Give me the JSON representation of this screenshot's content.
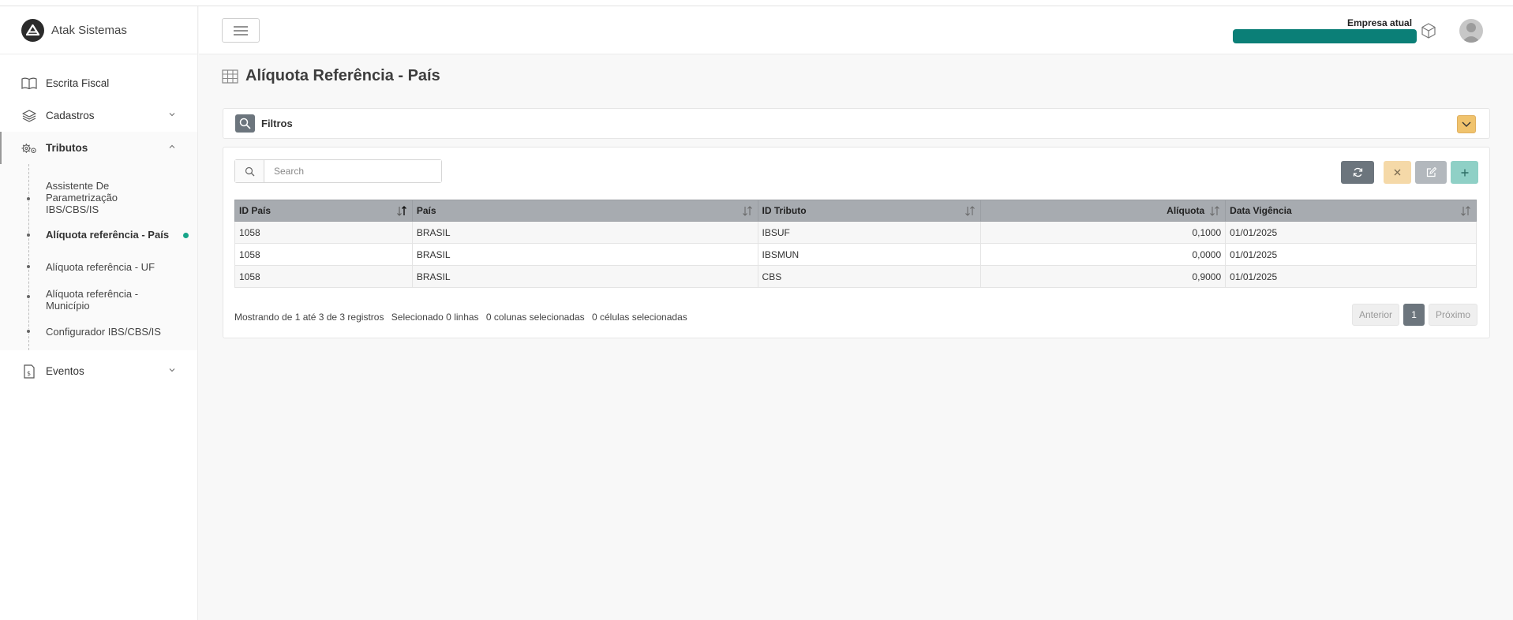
{
  "brand": {
    "name": "Atak Sistemas"
  },
  "sidebar": {
    "items": [
      {
        "label": "Escrita Fiscal"
      },
      {
        "label": "Cadastros"
      },
      {
        "label": "Tributos"
      },
      {
        "label": "Eventos"
      }
    ],
    "tributos_sub": [
      {
        "label": "Assistente De Parametrização IBS/CBS/IS"
      },
      {
        "label": "Alíquota referência - País"
      },
      {
        "label": "Alíquota referência - UF"
      },
      {
        "label": "Alíquota referência - Município"
      },
      {
        "label": "Configurador IBS/CBS/IS"
      }
    ]
  },
  "header": {
    "empresa_label": "Empresa atual",
    "empresa_bar_color": "#0b7f77"
  },
  "page": {
    "title": "Alíquota Referência - País"
  },
  "filters": {
    "label": "Filtros"
  },
  "search": {
    "placeholder": "Search"
  },
  "table": {
    "columns": [
      "ID País",
      "País",
      "ID Tributo",
      "Alíquota",
      "Data Vigência"
    ],
    "rows": [
      [
        "1058",
        "BRASIL",
        "IBSUF",
        "0,1000",
        "01/01/2025"
      ],
      [
        "1058",
        "BRASIL",
        "IBSMUN",
        "0,0000",
        "01/01/2025"
      ],
      [
        "1058",
        "BRASIL",
        "CBS",
        "0,9000",
        "01/01/2025"
      ]
    ]
  },
  "footer": {
    "showing": "Mostrando de 1 até 3 de 3 registros",
    "selected_rows": "Selecionado 0 linhas",
    "selected_cols": "0 colunas selecionadas",
    "selected_cells": "0 células selecionadas"
  },
  "pagination": {
    "prev": "Anterior",
    "page": "1",
    "next": "Próximo"
  },
  "colors": {
    "accent_green": "#17a589",
    "toggle_orange": "#f0c36d",
    "header_gray": "#a7abb0"
  }
}
